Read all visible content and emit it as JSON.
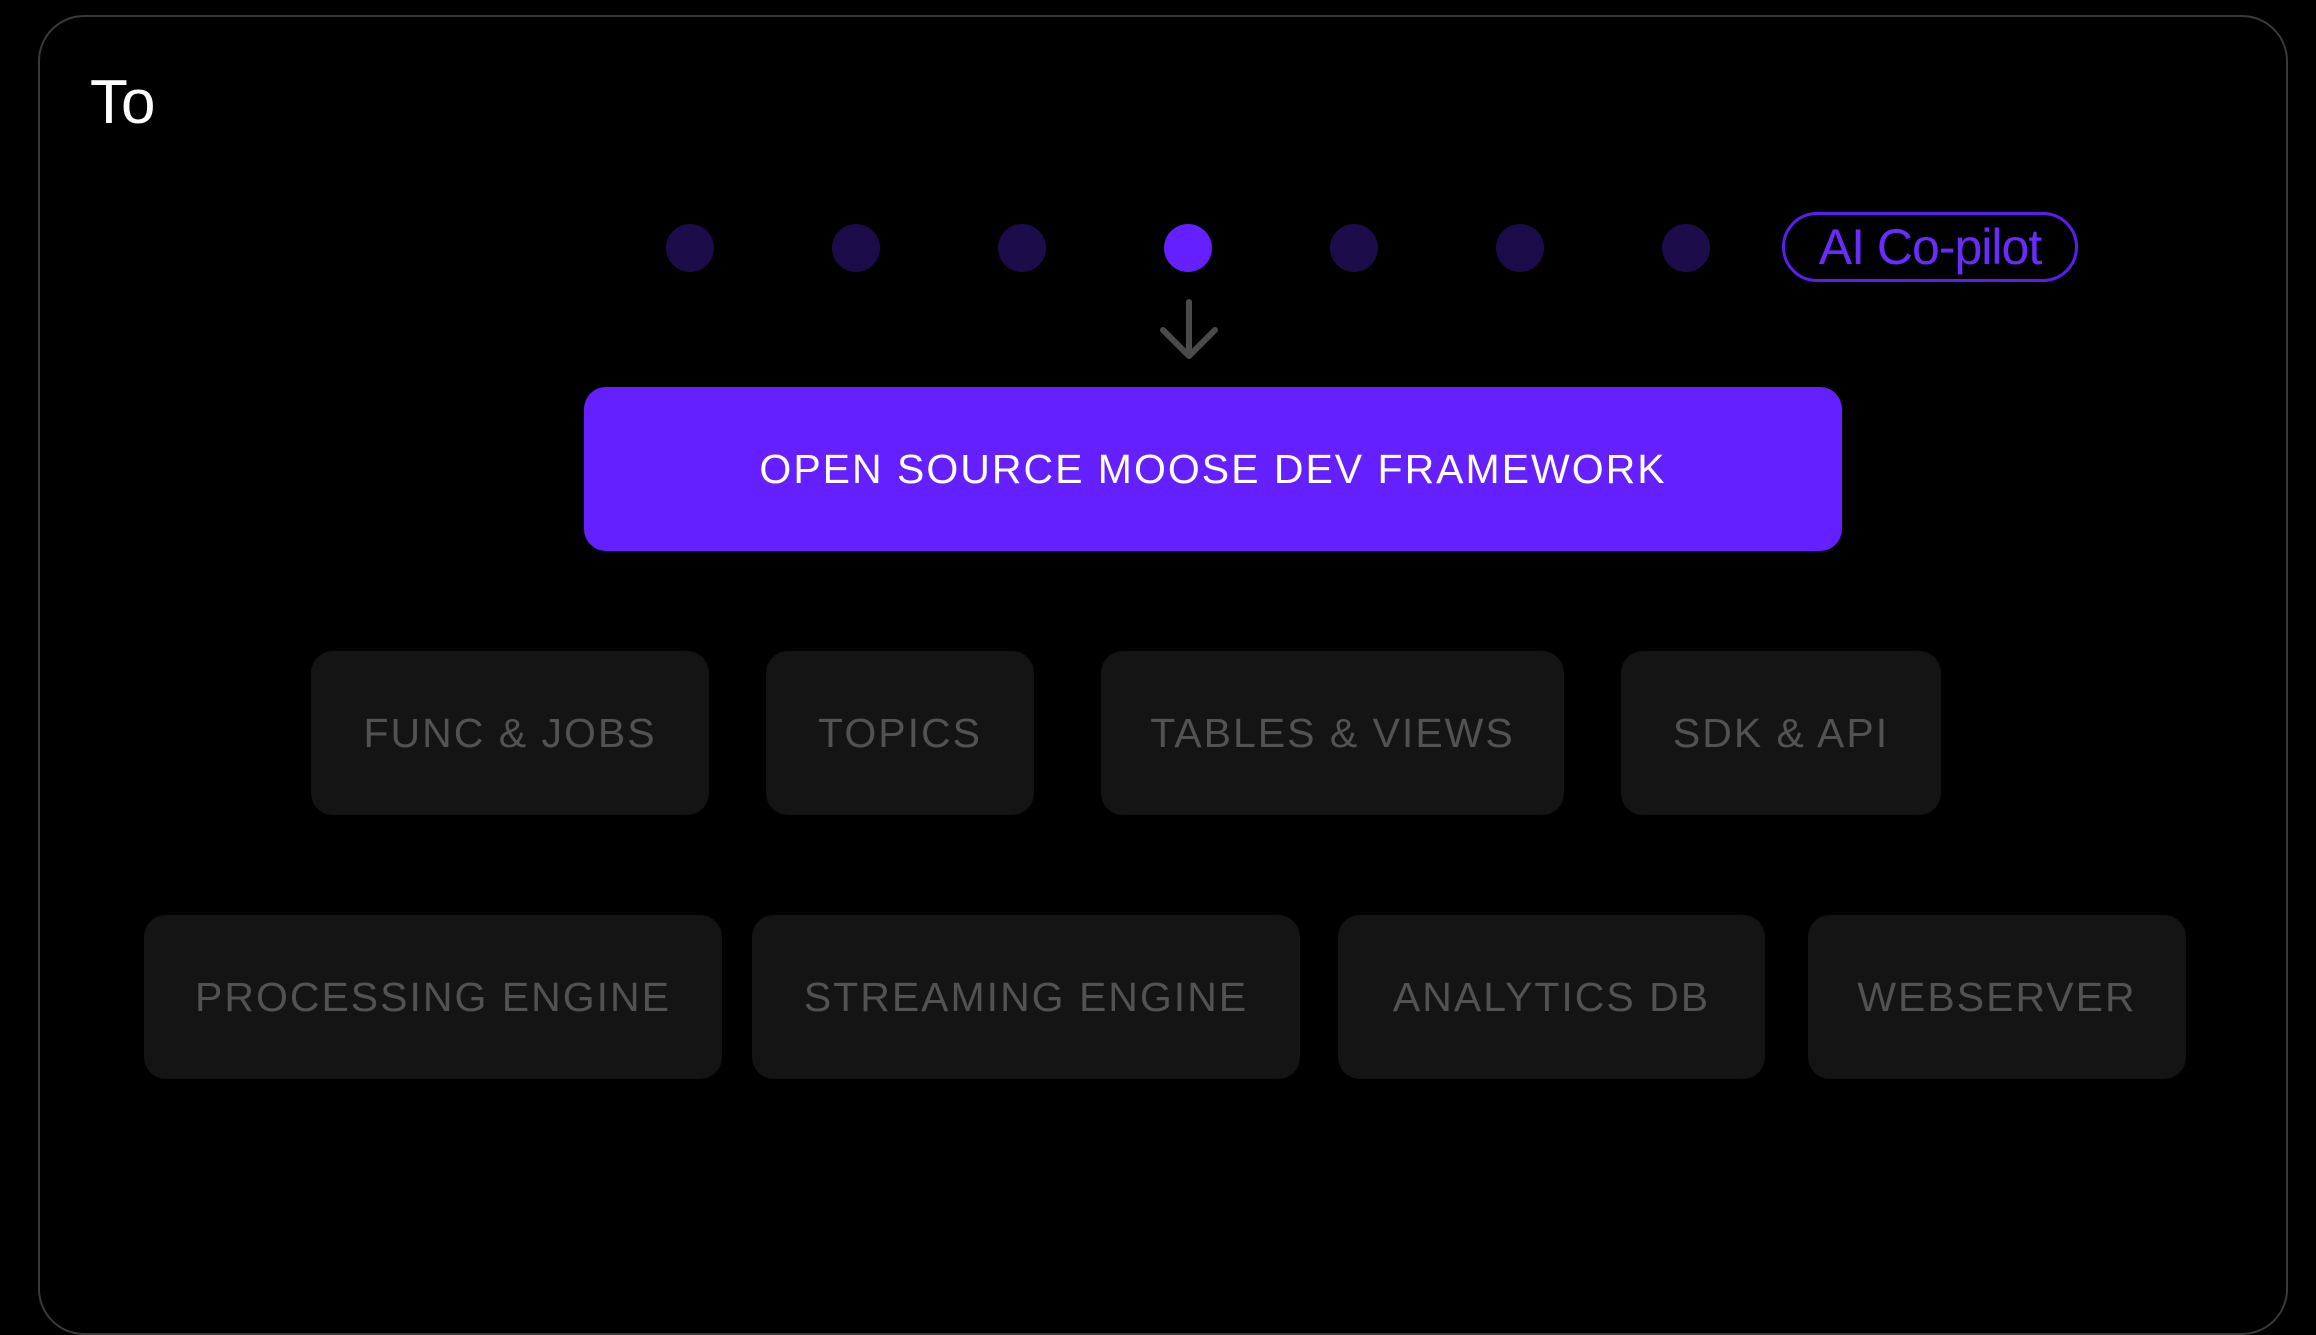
{
  "title": "To",
  "copilot_label": "AI Co-pilot",
  "dots": {
    "count": 7,
    "active_index": 3
  },
  "framework_label": "OPEN SOURCE MOOSE DEV FRAMEWORK",
  "row1": [
    "FUNC & JOBS",
    "TOPICS",
    "TABLES & VIEWS",
    "SDK & API"
  ],
  "row2": [
    "PROCESSING ENGINE",
    "STREAMING ENGINE",
    "ANALYTICS DB",
    "WEBSERVER"
  ],
  "colors": {
    "accent": "#6420ff",
    "dot_inactive": "#1c0c4a",
    "box_bg": "#141414",
    "box_text": "#525252",
    "arrow": "#4a4a4a"
  },
  "icons": {
    "arrow": "arrow-down-icon"
  }
}
